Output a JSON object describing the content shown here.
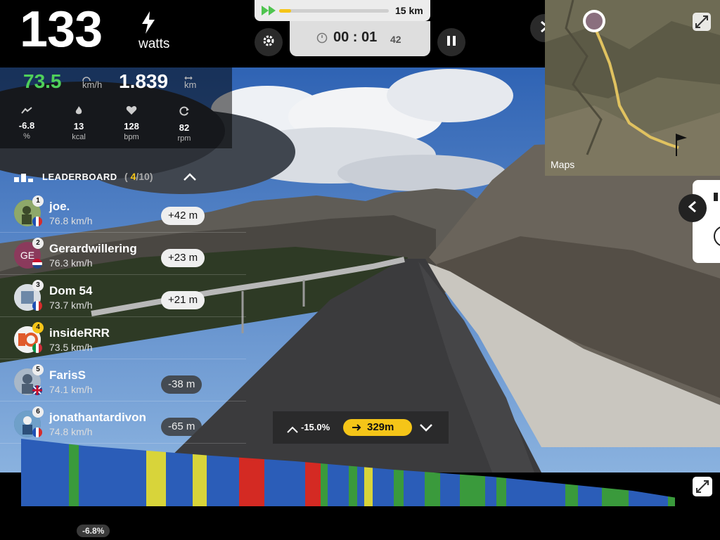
{
  "power": {
    "value": "133",
    "unit": "watts"
  },
  "route": {
    "progress": 0.11,
    "total_distance": "15 km"
  },
  "timer": {
    "main": "00 : 01",
    "seconds": "42"
  },
  "stats": {
    "speed": "73.5",
    "speed_unit": "km/h",
    "distance": "1.839",
    "distance_unit": "km",
    "items": [
      {
        "icon": "grade-icon",
        "value": "-6.8",
        "unit": "%"
      },
      {
        "icon": "calorie-flame-icon",
        "value": "13",
        "unit": "kcal"
      },
      {
        "icon": "heart-icon",
        "value": "128",
        "unit": "bpm"
      },
      {
        "icon": "cadence-icon",
        "value": "82",
        "unit": "rpm"
      }
    ]
  },
  "leaderboard": {
    "title": "LEADERBOARD",
    "open_paren": "(",
    "my_rank": "4",
    "total": "/10",
    "close_paren": ")",
    "riders": [
      {
        "rank": "1",
        "name": "joe.",
        "speed": "76.8 km/h",
        "gap": "+42 m",
        "gap_type": "ahead",
        "flag": "fr",
        "avatar_color": "#5d7a3a",
        "initials": ""
      },
      {
        "rank": "2",
        "name": "Gerardwillering",
        "speed": "76.3 km/h",
        "gap": "+23 m",
        "gap_type": "ahead",
        "flag": "nl",
        "avatar_color": "#8b3a5c",
        "initials": "GE"
      },
      {
        "rank": "3",
        "name": "Dom 54",
        "speed": "73.7 km/h",
        "gap": "+21 m",
        "gap_type": "ahead",
        "flag": "fr",
        "avatar_color": "#9fb3c8",
        "initials": ""
      },
      {
        "rank": "4",
        "name": "insideRRR",
        "speed": "73.5 km/h",
        "gap": "",
        "gap_type": "me",
        "flag": "it",
        "avatar_color": "#e05a2b",
        "initials": ""
      },
      {
        "rank": "5",
        "name": "FarisS",
        "speed": "74.1 km/h",
        "gap": "-38 m",
        "gap_type": "behind",
        "flag": "gb",
        "avatar_color": "#7a8fa8",
        "initials": ""
      },
      {
        "rank": "6",
        "name": "jonathantardivon",
        "speed": "74.8 km/h",
        "gap": "-65 m",
        "gap_type": "behind",
        "flag": "fr",
        "avatar_color": "#4a79a8",
        "initials": ""
      }
    ]
  },
  "map": {
    "label": "Maps"
  },
  "segment": {
    "grade": "-15.0%",
    "distance": "329m"
  },
  "elevation": {
    "current_grade": "-6.8%",
    "colors": {
      "blue": "#2b5db8",
      "green": "#3a9a3c",
      "yellow": "#d8d43a",
      "red": "#d42a23"
    },
    "bands": [
      {
        "w": 68,
        "c": "blue"
      },
      {
        "w": 14,
        "c": "green"
      },
      {
        "w": 96,
        "c": "blue"
      },
      {
        "w": 28,
        "c": "yellow"
      },
      {
        "w": 38,
        "c": "blue"
      },
      {
        "w": 20,
        "c": "yellow"
      },
      {
        "w": 46,
        "c": "blue"
      },
      {
        "w": 36,
        "c": "red"
      },
      {
        "w": 58,
        "c": "blue"
      },
      {
        "w": 22,
        "c": "red"
      },
      {
        "w": 10,
        "c": "green"
      },
      {
        "w": 30,
        "c": "blue"
      },
      {
        "w": 12,
        "c": "green"
      },
      {
        "w": 10,
        "c": "blue"
      },
      {
        "w": 12,
        "c": "yellow"
      },
      {
        "w": 30,
        "c": "blue"
      },
      {
        "w": 14,
        "c": "green"
      },
      {
        "w": 30,
        "c": "blue"
      },
      {
        "w": 22,
        "c": "green"
      },
      {
        "w": 28,
        "c": "blue"
      },
      {
        "w": 36,
        "c": "green"
      },
      {
        "w": 16,
        "c": "blue"
      },
      {
        "w": 14,
        "c": "green"
      },
      {
        "w": 84,
        "c": "blue"
      },
      {
        "w": 18,
        "c": "green"
      },
      {
        "w": 34,
        "c": "blue"
      },
      {
        "w": 38,
        "c": "green"
      },
      {
        "w": 56,
        "c": "blue"
      },
      {
        "w": 10,
        "c": "green"
      }
    ]
  }
}
